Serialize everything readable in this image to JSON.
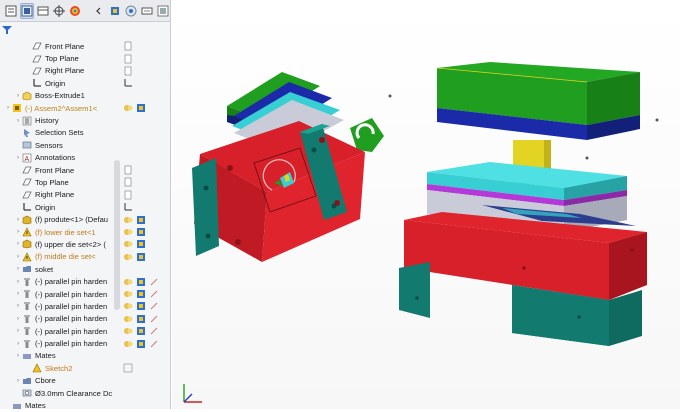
{
  "tree": [
    {
      "indent": 2,
      "exp": "",
      "icon": "plane",
      "label": "Front Plane",
      "style": ""
    },
    {
      "indent": 2,
      "exp": "",
      "icon": "plane",
      "label": "Top Plane",
      "style": ""
    },
    {
      "indent": 2,
      "exp": "",
      "icon": "plane",
      "label": "Right Plane",
      "style": ""
    },
    {
      "indent": 2,
      "exp": "",
      "icon": "origin",
      "label": "Origin",
      "style": ""
    },
    {
      "indent": 1,
      "exp": "›",
      "icon": "extrude",
      "label": "Boss-Extrude1",
      "style": ""
    },
    {
      "indent": 0,
      "exp": "›",
      "icon": "assembly-warn",
      "label": "(-) Assem2^Assem1<",
      "style": "warn"
    },
    {
      "indent": 1,
      "exp": "›",
      "icon": "history",
      "label": "History",
      "style": ""
    },
    {
      "indent": 1,
      "exp": "",
      "icon": "selection",
      "label": "Selection Sets",
      "style": ""
    },
    {
      "indent": 1,
      "exp": "",
      "icon": "sensor",
      "label": "Sensors",
      "style": ""
    },
    {
      "indent": 1,
      "exp": "›",
      "icon": "annotation",
      "label": "Annotations",
      "style": ""
    },
    {
      "indent": 1,
      "exp": "",
      "icon": "plane",
      "label": "Front Plane",
      "style": ""
    },
    {
      "indent": 1,
      "exp": "",
      "icon": "plane",
      "label": "Top Plane",
      "style": ""
    },
    {
      "indent": 1,
      "exp": "",
      "icon": "plane",
      "label": "Right Plane",
      "style": ""
    },
    {
      "indent": 1,
      "exp": "",
      "icon": "origin",
      "label": "Origin",
      "style": ""
    },
    {
      "indent": 1,
      "exp": "›",
      "icon": "part",
      "label": "(f) produte<1> (Defau",
      "style": ""
    },
    {
      "indent": 1,
      "exp": "›",
      "icon": "part-warn",
      "label": "(f) lower die set<1",
      "style": "orange"
    },
    {
      "indent": 1,
      "exp": "›",
      "icon": "part",
      "label": "(f) upper die set<2> (",
      "style": ""
    },
    {
      "indent": 1,
      "exp": "›",
      "icon": "part-warn",
      "label": "(f) middle die set<",
      "style": "orange"
    },
    {
      "indent": 1,
      "exp": "›",
      "icon": "folder",
      "label": "soket",
      "style": ""
    },
    {
      "indent": 1,
      "exp": "›",
      "icon": "pin",
      "label": "(-) parallel pin harden",
      "style": ""
    },
    {
      "indent": 1,
      "exp": "›",
      "icon": "pin",
      "label": "(-) parallel pin harden",
      "style": ""
    },
    {
      "indent": 1,
      "exp": "›",
      "icon": "pin",
      "label": "(-) parallel pin harden",
      "style": ""
    },
    {
      "indent": 1,
      "exp": "›",
      "icon": "pin",
      "label": "(-) parallel pin harden",
      "style": ""
    },
    {
      "indent": 1,
      "exp": "›",
      "icon": "pin",
      "label": "(-) parallel pin harden",
      "style": ""
    },
    {
      "indent": 1,
      "exp": "›",
      "icon": "pin",
      "label": "(-) parallel pin harden",
      "style": ""
    },
    {
      "indent": 1,
      "exp": "›",
      "icon": "mates",
      "label": "Mates",
      "style": ""
    },
    {
      "indent": 2,
      "exp": "",
      "icon": "sketch-warn",
      "label": "Sketch2",
      "style": "orange"
    },
    {
      "indent": 1,
      "exp": "›",
      "icon": "folder",
      "label": "Cbore",
      "style": ""
    },
    {
      "indent": 1,
      "exp": "",
      "icon": "hole",
      "label": "Ø3.0mm Clearance Dc",
      "style": ""
    },
    {
      "indent": 0,
      "exp": "",
      "icon": "mates",
      "label": "Mates",
      "style": ""
    }
  ],
  "colors": {
    "green": "#1f9e1f",
    "blue": "#1b2aa8",
    "yellow": "#e3d322",
    "cyan": "#37cfd3",
    "magenta": "#b33ad6",
    "red": "#d7202a",
    "teal": "#127a6e",
    "grey": "#c9ccd8"
  }
}
